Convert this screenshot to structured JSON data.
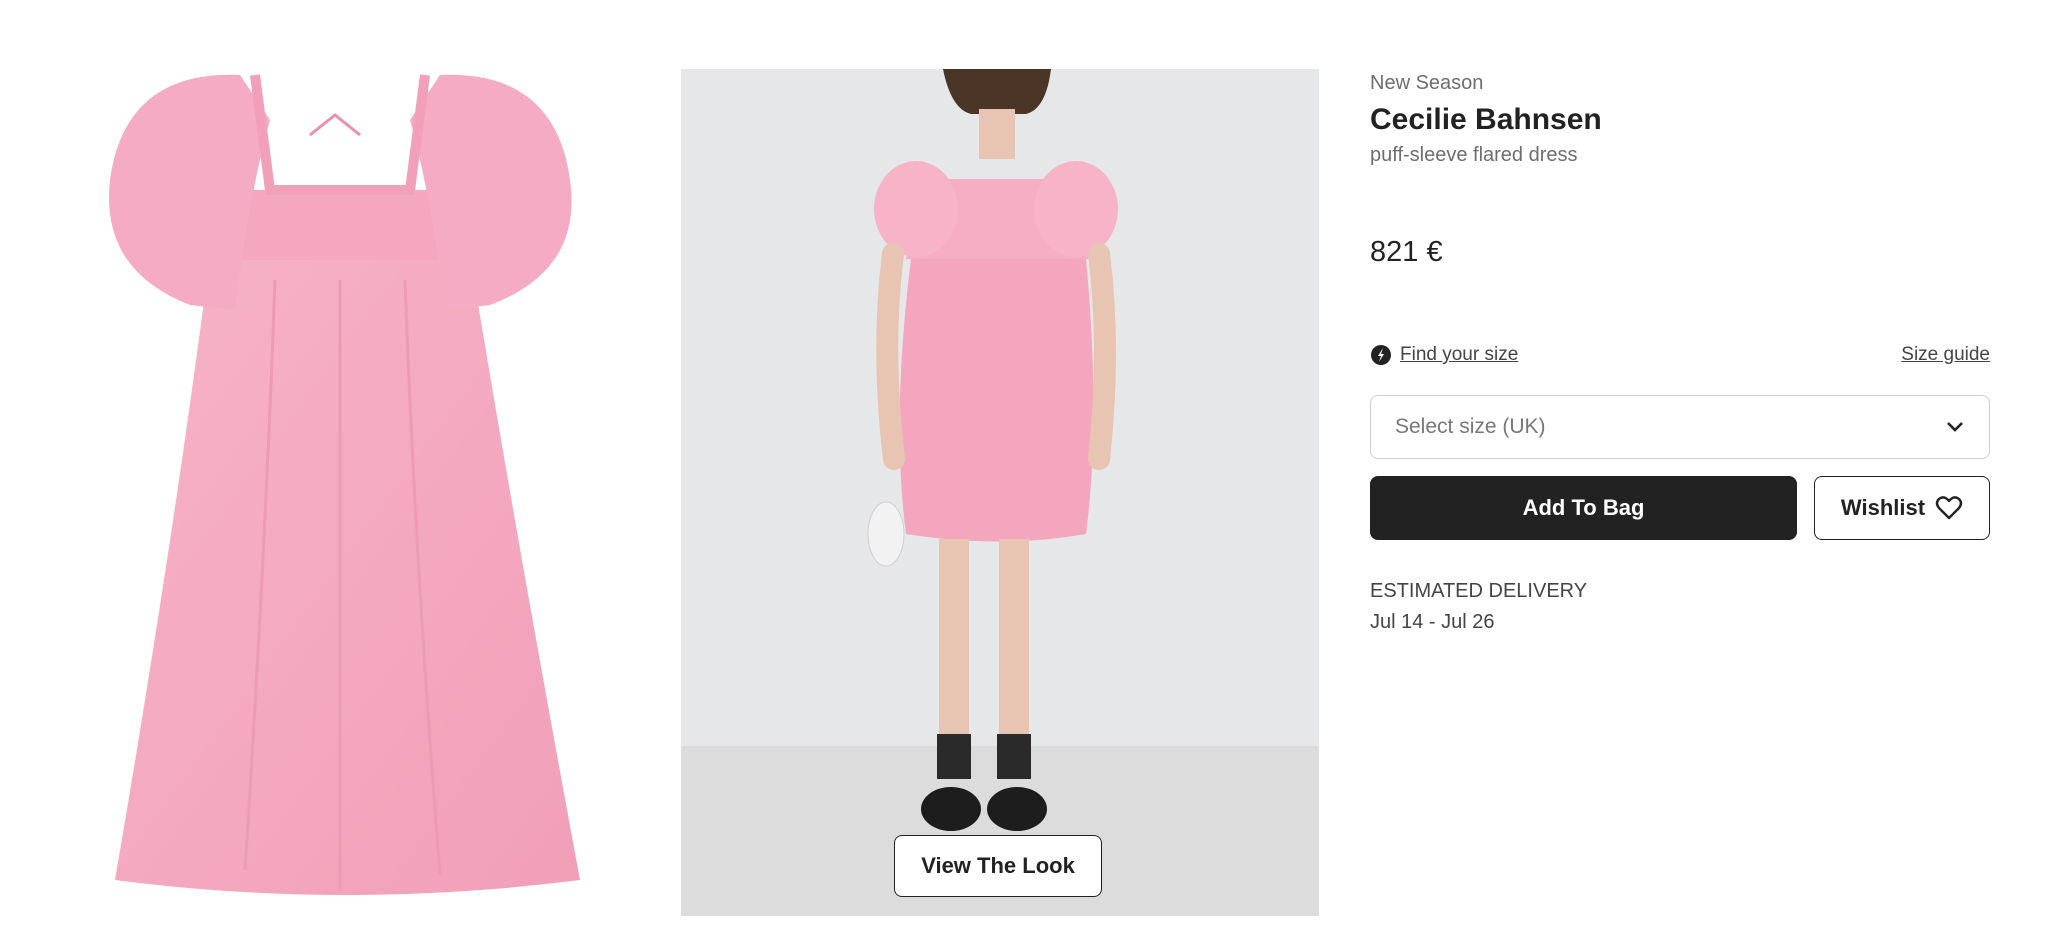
{
  "product": {
    "badge": "New Season",
    "brand": "Cecilie Bahnsen",
    "description": "puff-sleeve flared dress",
    "price": "821 €"
  },
  "sizing": {
    "find_size_label": "Find your size",
    "size_guide_label": "Size guide",
    "select_placeholder": "Select size (UK)"
  },
  "actions": {
    "add_to_bag_label": "Add To Bag",
    "wishlist_label": "Wishlist"
  },
  "delivery": {
    "label": "ESTIMATED DELIVERY",
    "dates": "Jul 14 - Jul 26"
  },
  "gallery": {
    "view_look_label": "View The Look"
  },
  "colors": {
    "dress_pink": "#f4a9c0",
    "button_dark": "#222222",
    "photo_background": "#e6e7e9"
  },
  "icons": {
    "find_size": "size-finder-icon",
    "select": "chevron-down-icon",
    "wishlist": "heart-outline-icon"
  }
}
